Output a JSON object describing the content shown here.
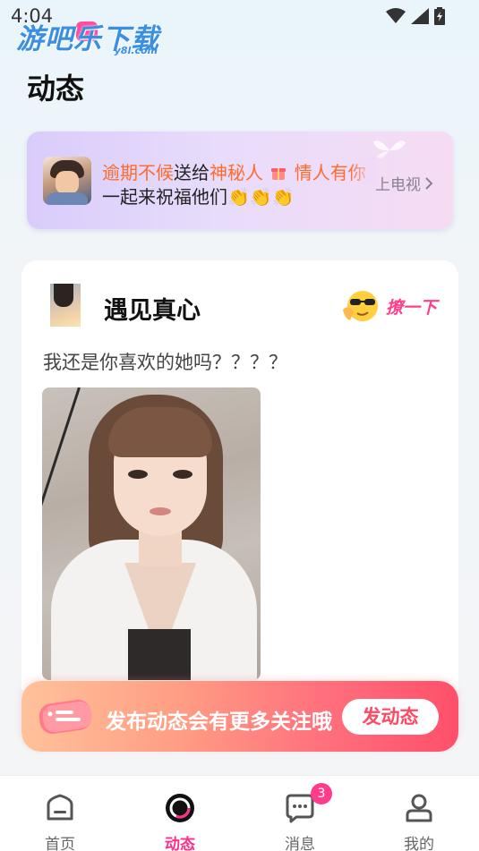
{
  "status_bar": {
    "time": "4:04"
  },
  "watermark": {
    "text": "游吧乐下载",
    "sub": "y8l.com"
  },
  "page": {
    "title": "动态"
  },
  "banner": {
    "part1": "逾期不候",
    "part2": "送给",
    "part3": "神秘人",
    "part4": "情人有你",
    "line2": "一起来祝福他们👏👏👏",
    "link_label": "上电视"
  },
  "post": {
    "username": "遇见真心",
    "flirt_label": "撩一下",
    "text": "我还是你喜欢的她吗？？？？"
  },
  "promo": {
    "text": "发布动态会有更多关注哦",
    "button_label": "发动态"
  },
  "tabs": [
    {
      "label": "首页"
    },
    {
      "label": "动态"
    },
    {
      "label": "消息",
      "badge": "3"
    },
    {
      "label": "我的"
    }
  ],
  "colors": {
    "accent": "#ff2f88",
    "highlight": "#ff6b2c",
    "promo_end": "#ff4f6a"
  }
}
